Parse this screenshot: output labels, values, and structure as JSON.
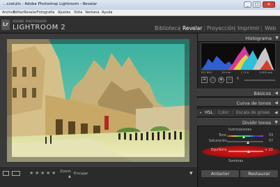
{
  "window": {
    "title": "…ccelulis - Adobe Photoshop Lightroom - Revelar"
  },
  "menu": [
    "Archivo",
    "Editar",
    "Revelar",
    "Fotografía",
    "Ajustes",
    "Vista",
    "Ventana",
    "Ayuda"
  ],
  "brand": {
    "sub": "ADOBE PHOTOSHOP",
    "main": "LIGHTROOM 2",
    "logo": "Lr"
  },
  "modules": [
    "Biblioteca",
    "Revelar",
    "Proyección",
    "Imprimir",
    "Web"
  ],
  "panels": {
    "histogram": "Histograma",
    "histo_info": [
      "ISO 800",
      "18 mm",
      "f / 5,6",
      "1/400 seg"
    ],
    "basicos": "Básicos",
    "curva": "Curva de tonos",
    "tabs": [
      "HSL",
      "Color",
      "Escala de grises"
    ],
    "dividir": "Dividir tonos",
    "highlights_label": "Iluminaciones",
    "tono_label": "Tono",
    "tono_value": "53",
    "saturacion_label": "Saturación",
    "saturacion_value": "57",
    "equilibrio_label": "Equilibrio",
    "equilibrio_value": "+ 23",
    "sombras_label": "Sombras"
  },
  "buttons": {
    "anterior": "Anterior",
    "restaurar": "Restaurar"
  },
  "toolbar": {
    "zoom": "Zoom",
    "encajar": "Encajar"
  },
  "colors": {
    "highlight": "#d21a1a",
    "panel": "#262626",
    "header": "#303030"
  }
}
